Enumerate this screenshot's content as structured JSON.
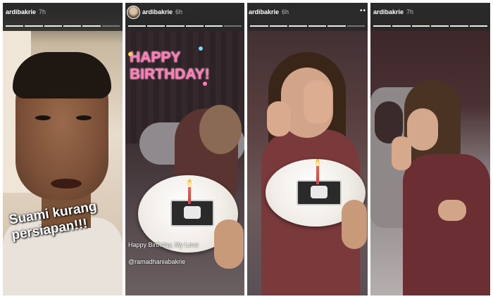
{
  "stories": [
    {
      "username": "ardibakrie",
      "time": "7h",
      "caption": "Suami kurang persiapan!!!"
    },
    {
      "username": "ardibakrie",
      "time": "6h",
      "sticker": "HAPPY BIRTHDAY!",
      "caption": "Happy Birthday, My Love",
      "mention": "@ramadhaniabakrie"
    },
    {
      "username": "ardibakrie",
      "time": "6h",
      "more_icon": "more-dots-icon"
    },
    {
      "username": "ardibakrie",
      "time": "7h"
    }
  ],
  "colors": {
    "sticker_pink": "#ff7ab6",
    "topbar": "#2a2a2a"
  }
}
